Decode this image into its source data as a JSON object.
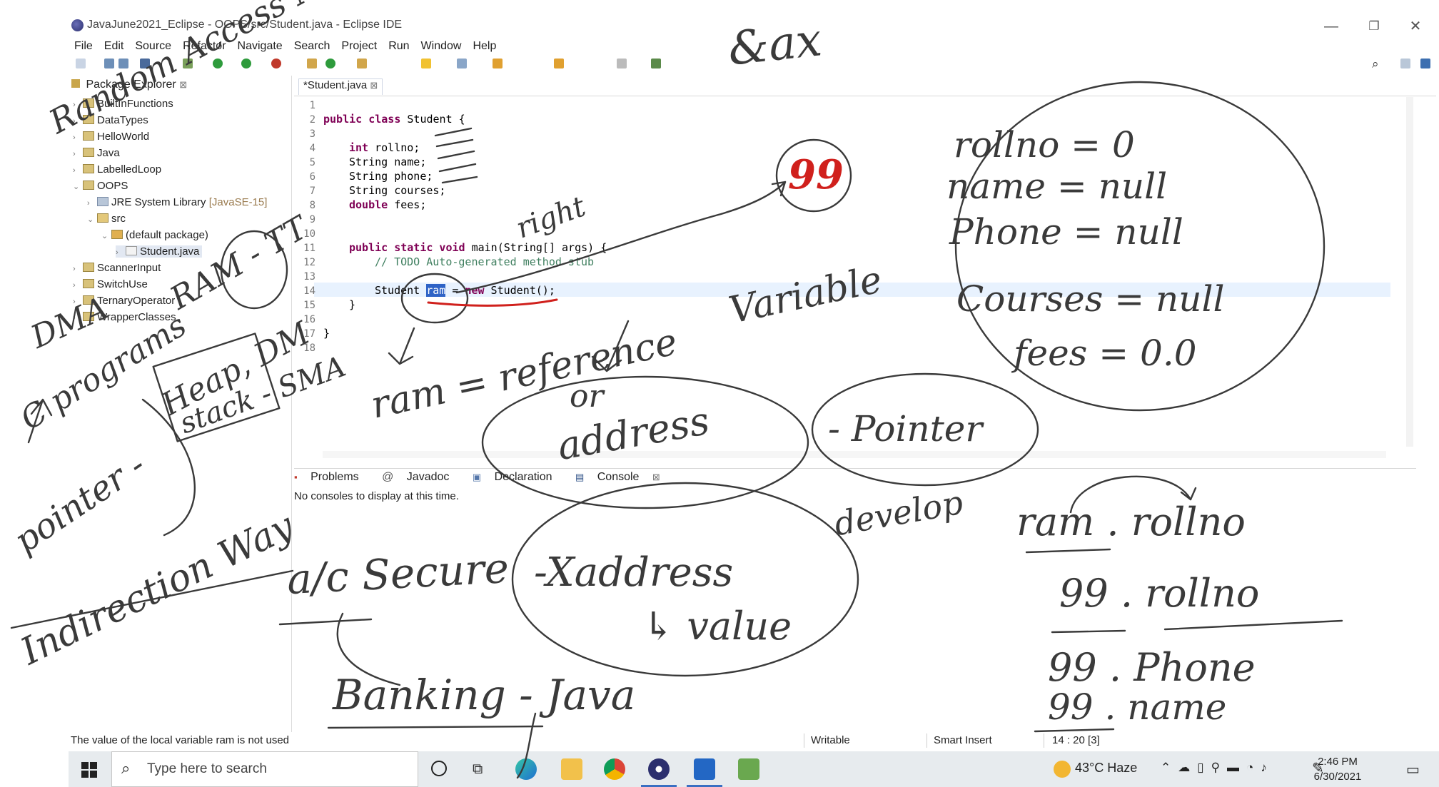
{
  "window": {
    "title": "JavaJune2021_Eclipse - OOPS/src/Student.java - Eclipse IDE",
    "min": "—",
    "restore": "❐",
    "close": "✕"
  },
  "menu": [
    "File",
    "Edit",
    "Source",
    "Refactor",
    "Navigate",
    "Search",
    "Project",
    "Run",
    "Window",
    "Help"
  ],
  "package_explorer": {
    "tab_label": "Package Explorer",
    "tab_close": "⊠",
    "items": [
      {
        "label": "BuiltInFunctions"
      },
      {
        "label": "DataTypes"
      },
      {
        "label": "HelloWorld"
      },
      {
        "label": "Java"
      },
      {
        "label": "LabelledLoop"
      },
      {
        "label": "OOPS"
      },
      {
        "label": "JRE System Library",
        "suffix": "[JavaSE-15]"
      },
      {
        "label": "src"
      },
      {
        "label": "(default package)"
      },
      {
        "label": "Student.java"
      },
      {
        "label": "ScannerInput"
      },
      {
        "label": "SwitchUse"
      },
      {
        "label": "TernaryOperator"
      },
      {
        "label": "WrapperClasses"
      }
    ]
  },
  "editor": {
    "tab_label": "*Student.java",
    "tab_close": "⊠",
    "line_numbers": [
      "1",
      "2",
      "3",
      "4",
      "5",
      "6",
      "7",
      "8",
      "9",
      "10",
      "11",
      "12",
      "13",
      "14",
      "15",
      "16",
      "17",
      "18"
    ],
    "code": {
      "l2_kw": "public class",
      "l2_rest": " Student {",
      "l4_kw": "int",
      "l4_rest": " rollno;",
      "l5": "String name;",
      "l6": "String phone;",
      "l7": "String courses;",
      "l8_kw": "double",
      "l8_rest": " fees;",
      "l11_kw": "public static void",
      "l11_rest": " main(String[] args) {",
      "l12": "// TODO Auto-generated method stub",
      "l14_a": "Student ",
      "l14_sel": "ram",
      "l14_b": " = ",
      "l14_kw": "new",
      "l14_c": " Student();",
      "l15": "}",
      "l17": "}"
    }
  },
  "console": {
    "tabs": [
      "Problems",
      "Javadoc",
      "Declaration",
      "Console"
    ],
    "active_close": "⊠",
    "message": "No consoles to display at this time."
  },
  "statusbar": {
    "message": "The value of the local variable ram is not used",
    "writable": "Writable",
    "insert_mode": "Smart Insert",
    "position": "14 : 20 [3]"
  },
  "taskbar": {
    "search_placeholder": "Type here to search",
    "weather": "43°C  Haze",
    "time": "2:46 PM",
    "date": "6/30/2021"
  },
  "annotations": {
    "top": "&ax",
    "red_number": "99",
    "fields": [
      "rollno = 0",
      "name = null",
      "Phone = null",
      "Courses = null",
      "fees = 0.0"
    ],
    "right": "right",
    "variable": "Variable",
    "reference": "ram = reference",
    "or": "or",
    "address": "address",
    "pointer": "- Pointer",
    "develop": "develop",
    "ram_rollno": "ram . rollno",
    "r99_rollno": "99 . rollno",
    "r99_phone": "99 . Phone",
    "r99_name": "99 . name",
    "secure": "a/c Secure",
    "xaddress": "-Xaddress",
    "value": "↳ value",
    "banking": "Banking - Java",
    "left_1": "Random Access Memory",
    "left_2": "RAM - TT",
    "left_3": "DMA",
    "left_4": "C programs",
    "left_5": "Heap, DM",
    "left_6": "stack - SMA",
    "left_7": "pointer -",
    "left_8": "Indirection Way"
  }
}
